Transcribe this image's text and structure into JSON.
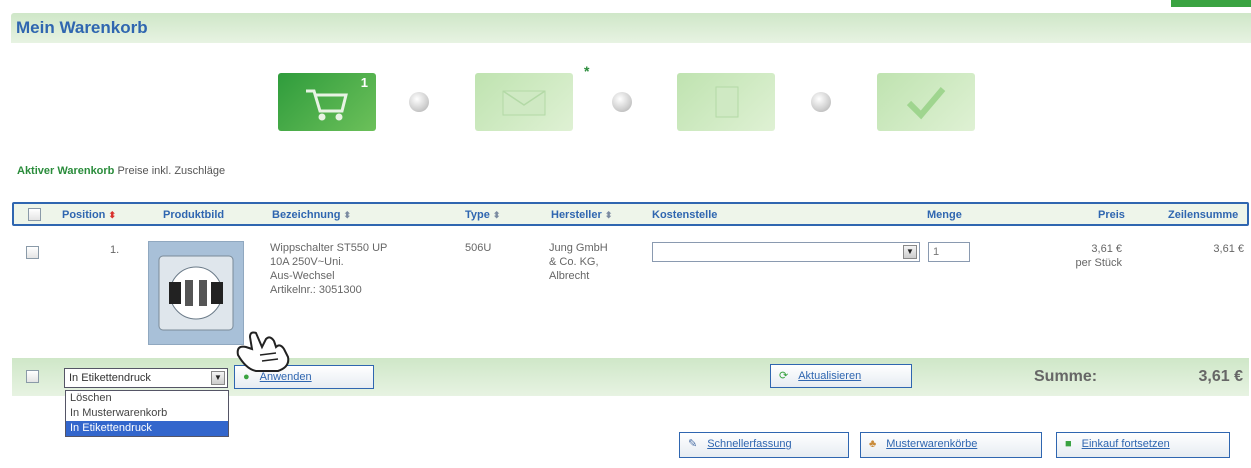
{
  "header": {
    "title": "Mein Warenkorb"
  },
  "steps": {
    "cart_count": "1",
    "asterisk": "*"
  },
  "info": {
    "active_label": "Aktiver Warenkorb",
    "suffix": " Preise inkl. Zuschläge"
  },
  "table": {
    "columns": {
      "position": "Position",
      "image": "Produktbild",
      "name": "Bezeichnung",
      "type": "Type",
      "manufacturer": "Hersteller",
      "cost_center": "Kostenstelle",
      "quantity": "Menge",
      "price": "Preis",
      "line_total": "Zeilensumme"
    },
    "rows": [
      {
        "position": "1.",
        "name_line1": "Wippschalter ST550 UP",
        "name_line2": "10A 250V~Uni.",
        "name_line3": "Aus-Wechsel",
        "article": "Artikelnr.: 3051300",
        "type": "506U",
        "manufacturer_line1": "Jung GmbH",
        "manufacturer_line2": "& Co. KG,",
        "manufacturer_line3": "Albrecht",
        "quantity": "1",
        "price": "3,61 €",
        "price_unit": "per Stück",
        "line_total": "3,61 €"
      }
    ]
  },
  "actions": {
    "selected": "In Etikettendruck",
    "options": [
      "Löschen",
      "In Musterwarenkorb",
      "In Etikettendruck"
    ],
    "apply_label": "Anwenden",
    "update_label": "Aktualisieren",
    "sum_label": "Summe:",
    "sum_value": "3,61 €"
  },
  "bottom_buttons": {
    "quick_entry": "Schnellerfassung",
    "sample_carts": "Musterwarenkörbe",
    "continue_shopping": "Einkauf fortsetzen"
  },
  "colors": {
    "accent": "#2f66b0",
    "green": "#3aa341",
    "band": "#d6ebcf"
  }
}
